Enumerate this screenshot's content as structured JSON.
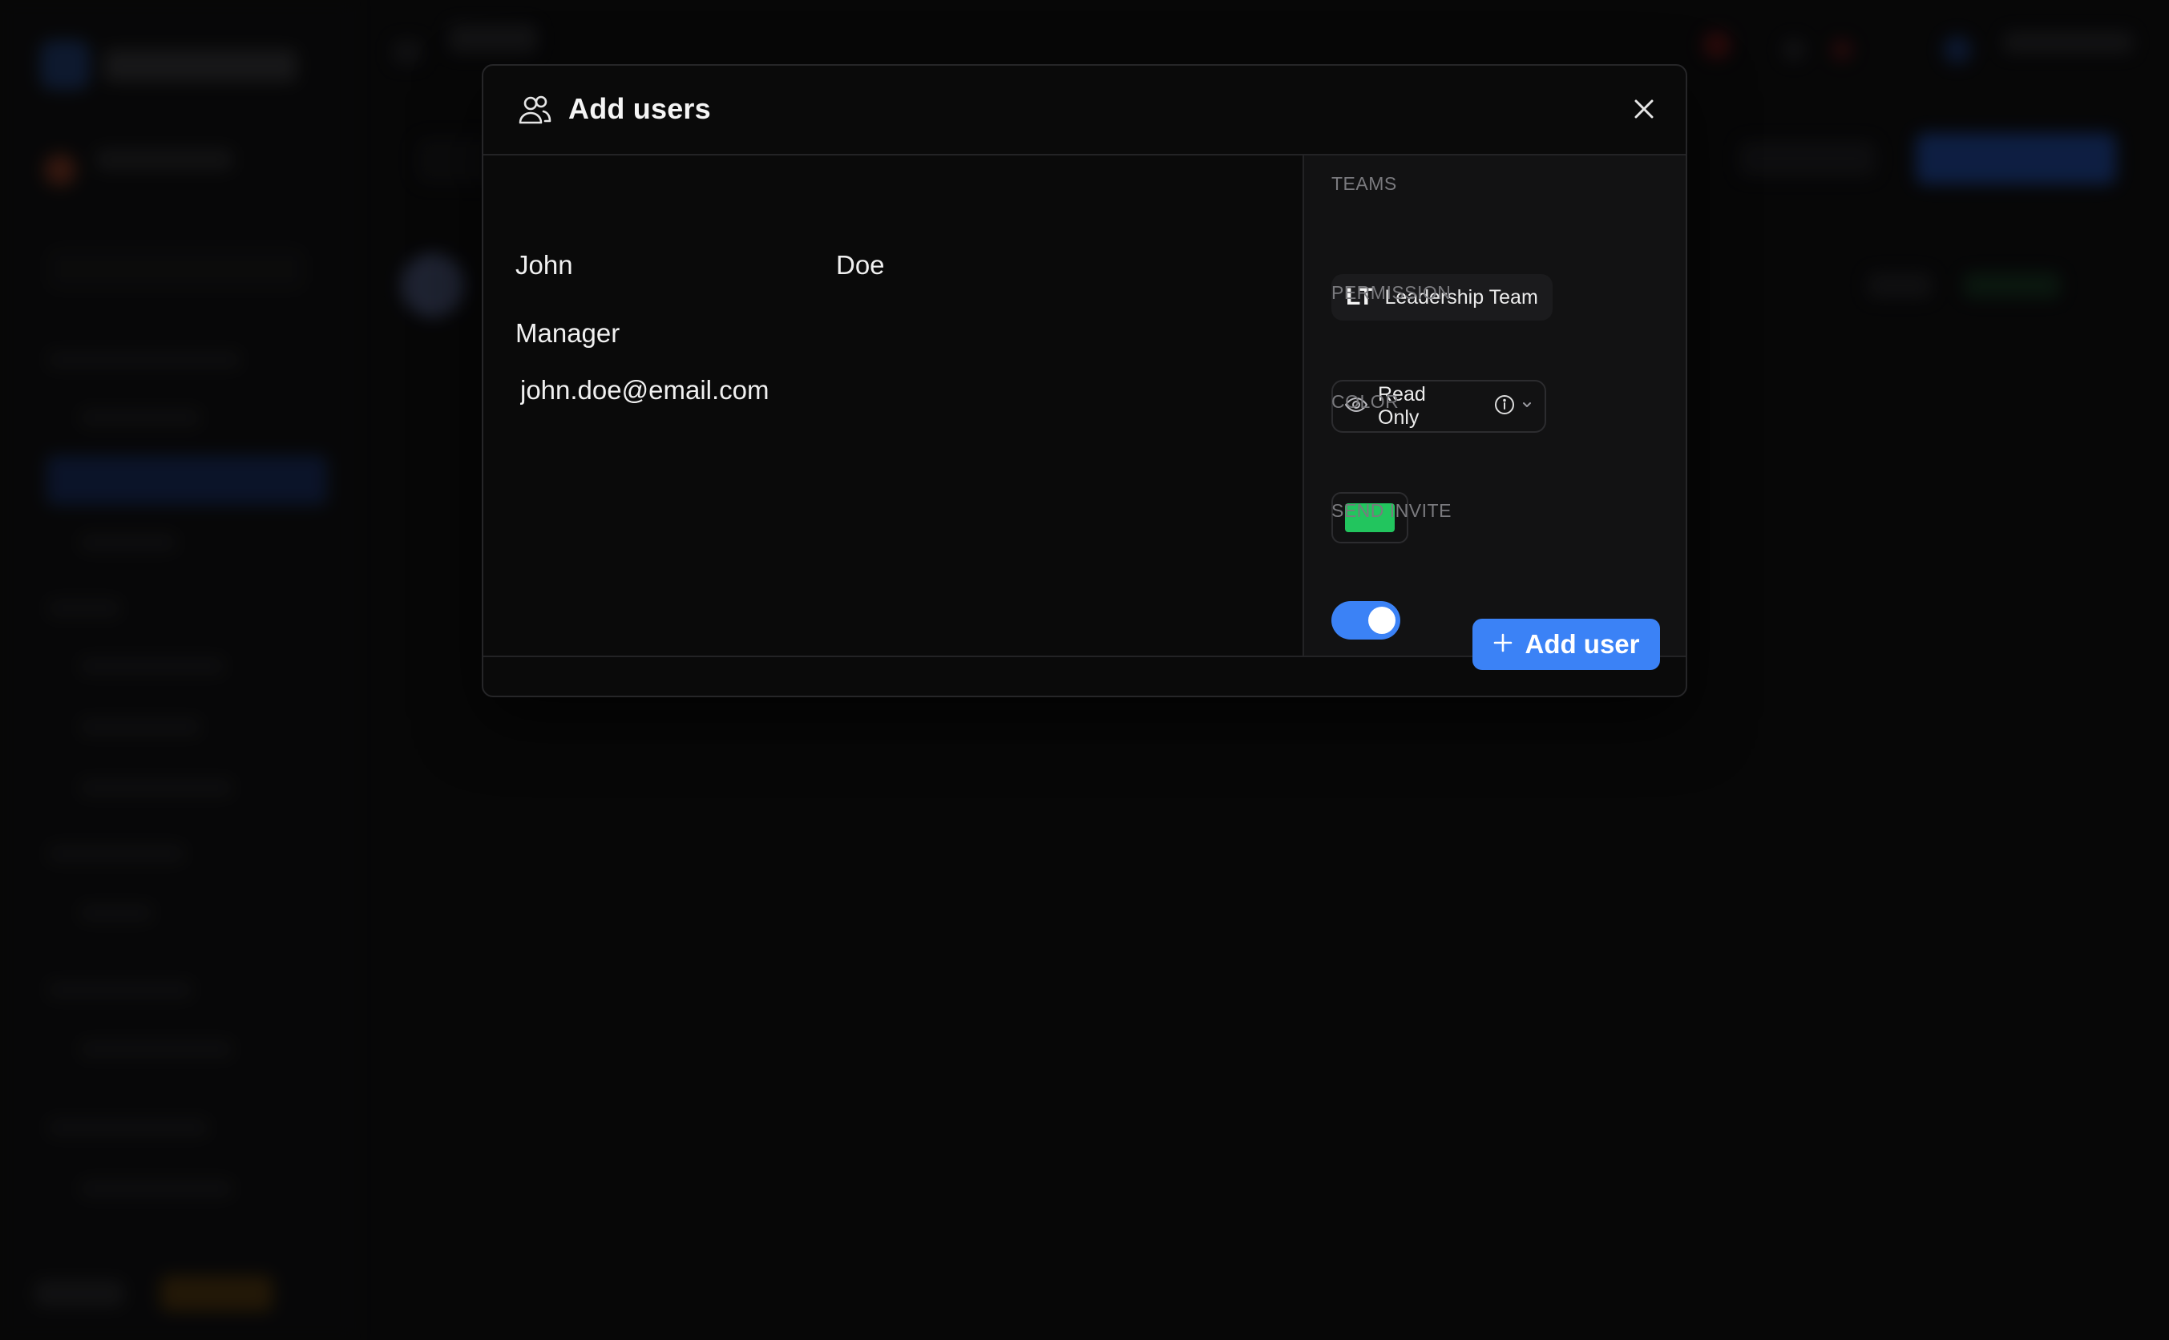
{
  "modal": {
    "title": "Add users",
    "icon": "users-icon",
    "close_icon": "close-icon"
  },
  "form": {
    "first_name": "John",
    "last_name": "Doe",
    "job_title": "Manager",
    "email": "john.doe@email.com"
  },
  "settings": {
    "teams_label": "TEAMS",
    "team": {
      "abbr": "LT",
      "name": "Leadership Team"
    },
    "permission_label": "PERMISSION",
    "permission_value": "Read Only",
    "permission_icon": "eye-icon",
    "color_label": "COLOR",
    "color_value": "#22c55e",
    "send_invite_label": "SEND INVITE",
    "send_invite_enabled": true
  },
  "footer": {
    "add_user_label": "Add user",
    "add_user_icon": "plus-icon"
  },
  "colors": {
    "accent": "#3b82f6",
    "modal_bg": "#0a0a0a",
    "panel_bg": "#121213"
  }
}
